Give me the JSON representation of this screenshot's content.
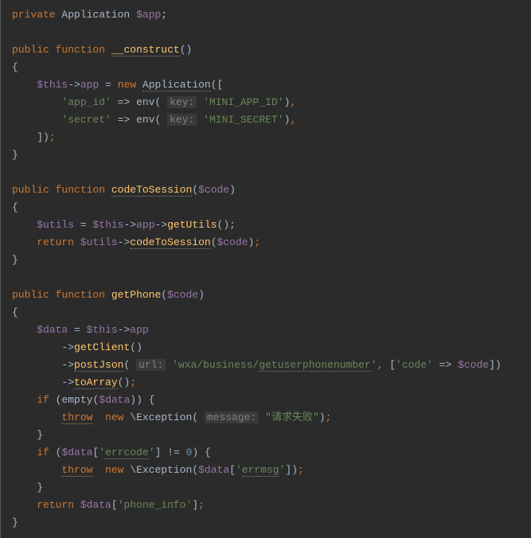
{
  "tokens": {
    "private": "private",
    "public": "public",
    "function": "function",
    "new": "new",
    "return": "return",
    "if": "if",
    "throw": "throw",
    "this": "$this",
    "app": "app",
    "appVar": "$app",
    "utils": "$utils",
    "code": "$code",
    "data": "$data",
    "Application": "Application",
    "Exception": "Exception",
    "construct": "__construct",
    "codeToSession": "codeToSession",
    "getPhone": "getPhone",
    "getUtils": "getUtils",
    "getClient": "getClient",
    "postJson": "postJson",
    "toArray": "toArray",
    "empty": "empty",
    "app_id": "'app_id'",
    "secret": "'secret'",
    "mini_app_id": "'MINI_APP_ID'",
    "mini_secret": "'MINI_SECRET'",
    "env": "env",
    "key_hint": "key:",
    "url_hint": "url:",
    "message_hint": "message:",
    "url_str1": "'wxa/business/",
    "url_str2": "getuserphonenumber",
    "url_str3": "'",
    "code_key": "'code'",
    "err_msg": "\"请求失败\"",
    "errcode": "errcode",
    "errmsg": "errmsg",
    "phone_info": "'phone_info'",
    "zero": "0",
    "arrow": "->",
    "fat_arrow": "=>",
    "neq": "!=",
    "assign": "=",
    "lparen": "(",
    "rparen": ")",
    "lbrace": "{",
    "rbrace": "}",
    "lbracket": "[",
    "rbracket": "]",
    "semi": ";",
    "comma": ",",
    "backslash": "\\",
    "squote": "'"
  }
}
